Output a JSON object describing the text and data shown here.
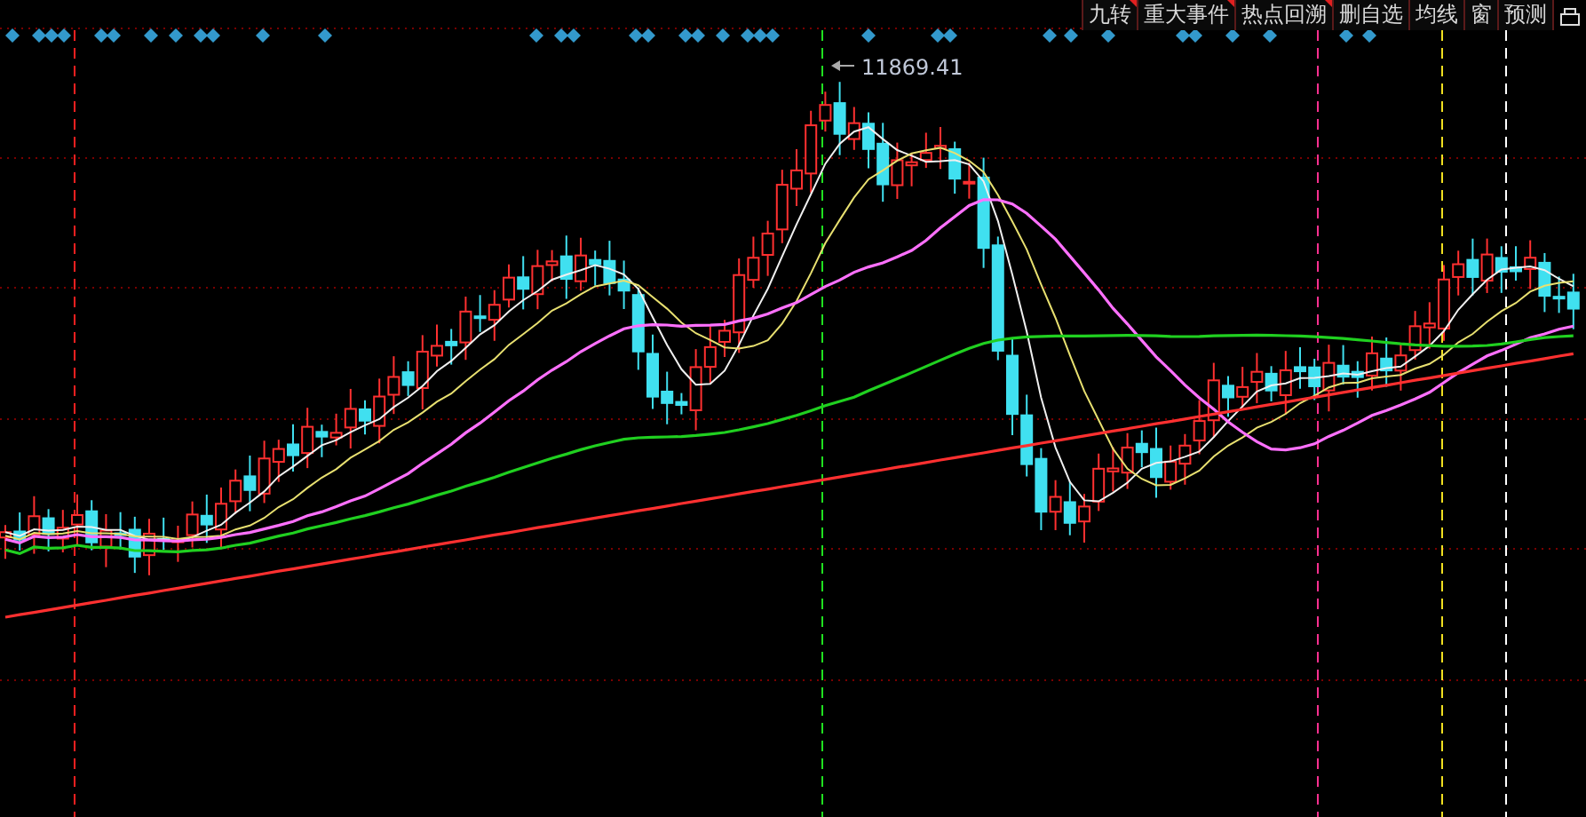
{
  "toolbar": [
    {
      "label": "九转",
      "flagged": true
    },
    {
      "label": "重大事件",
      "flagged": true
    },
    {
      "label": "热点回溯",
      "flagged": true
    },
    {
      "label": "删自选",
      "flagged": false
    },
    {
      "label": "均线",
      "flagged": false
    },
    {
      "label": "窗",
      "flagged": false
    },
    {
      "label": "预测",
      "flagged": false
    }
  ],
  "peak_label": "11869.41"
}
